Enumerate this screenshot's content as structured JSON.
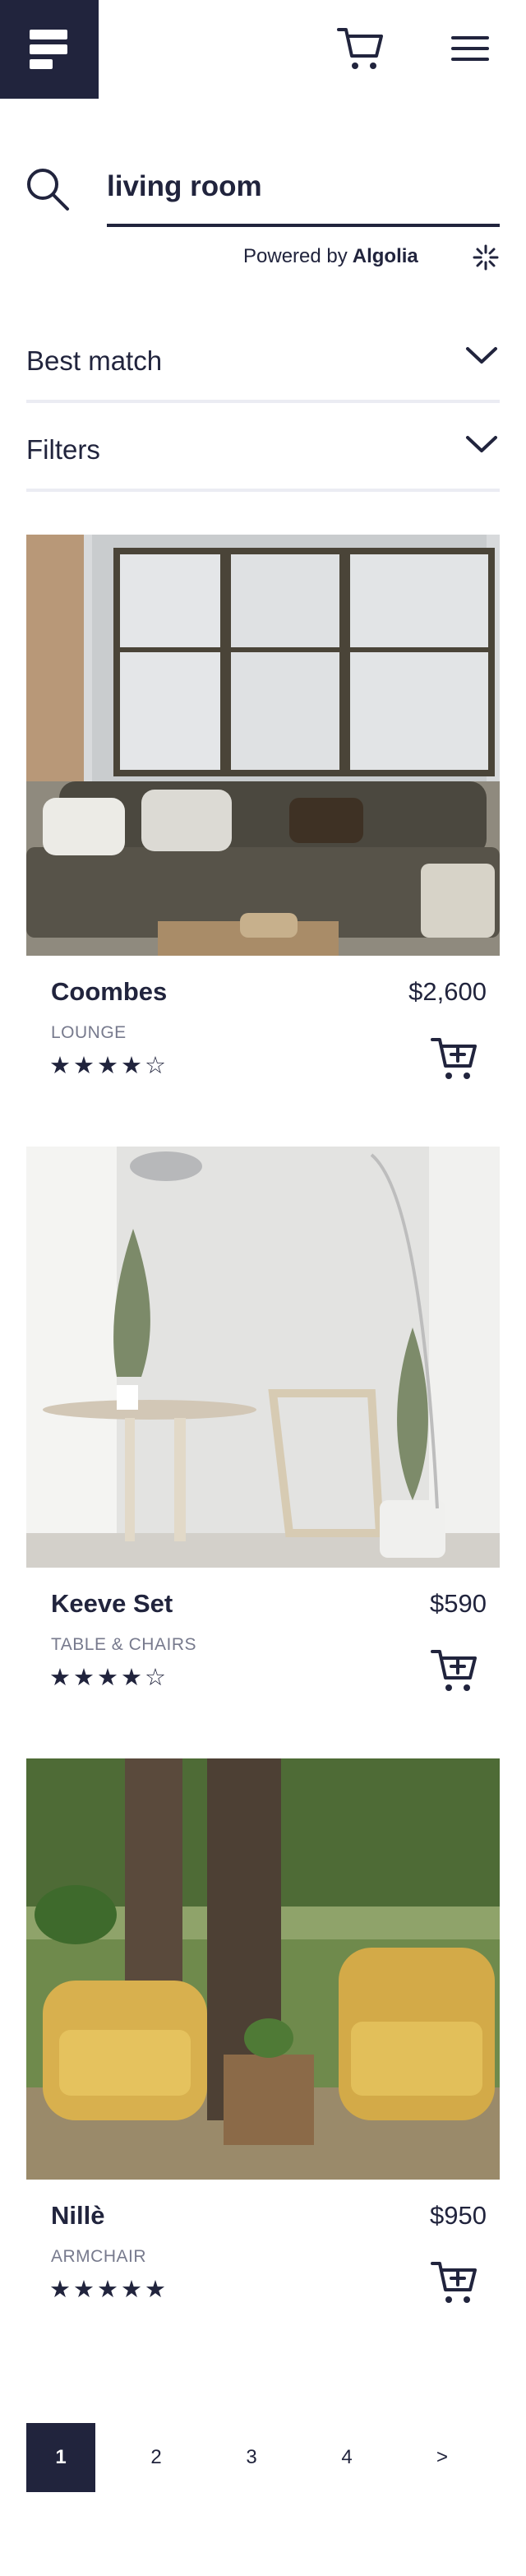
{
  "header": {
    "logo_icon": "logo-icon",
    "cart_icon": "cart-icon",
    "menu_icon": "hamburger-menu-icon"
  },
  "search": {
    "icon": "search-icon",
    "value": "living room",
    "powered_prefix": "Powered by",
    "powered_brand": "Algolia",
    "brand_icon": "algolia-icon"
  },
  "sort": {
    "label": "Best match",
    "icon": "chevron-down-icon"
  },
  "filters": {
    "label": "Filters",
    "icon": "chevron-down-icon"
  },
  "products": [
    {
      "name": "Coombes",
      "price": "$2,600",
      "category": "LOUNGE",
      "rating": 4,
      "stars": "★★★★☆"
    },
    {
      "name": "Keeve Set",
      "price": "$590",
      "category": "TABLE & CHAIRS",
      "rating": 4,
      "stars": "★★★★☆"
    },
    {
      "name": "Nillè",
      "price": "$950",
      "category": "ARMCHAIR",
      "rating": 5,
      "stars": "★★★★★"
    }
  ],
  "pagination": {
    "pages": [
      "1",
      "2",
      "3",
      "4"
    ],
    "next": ">",
    "current": "1"
  },
  "colors": {
    "primary": "#21243d",
    "divider": "#ebecf3",
    "muted": "#777a8d",
    "background": "#ffffff"
  }
}
